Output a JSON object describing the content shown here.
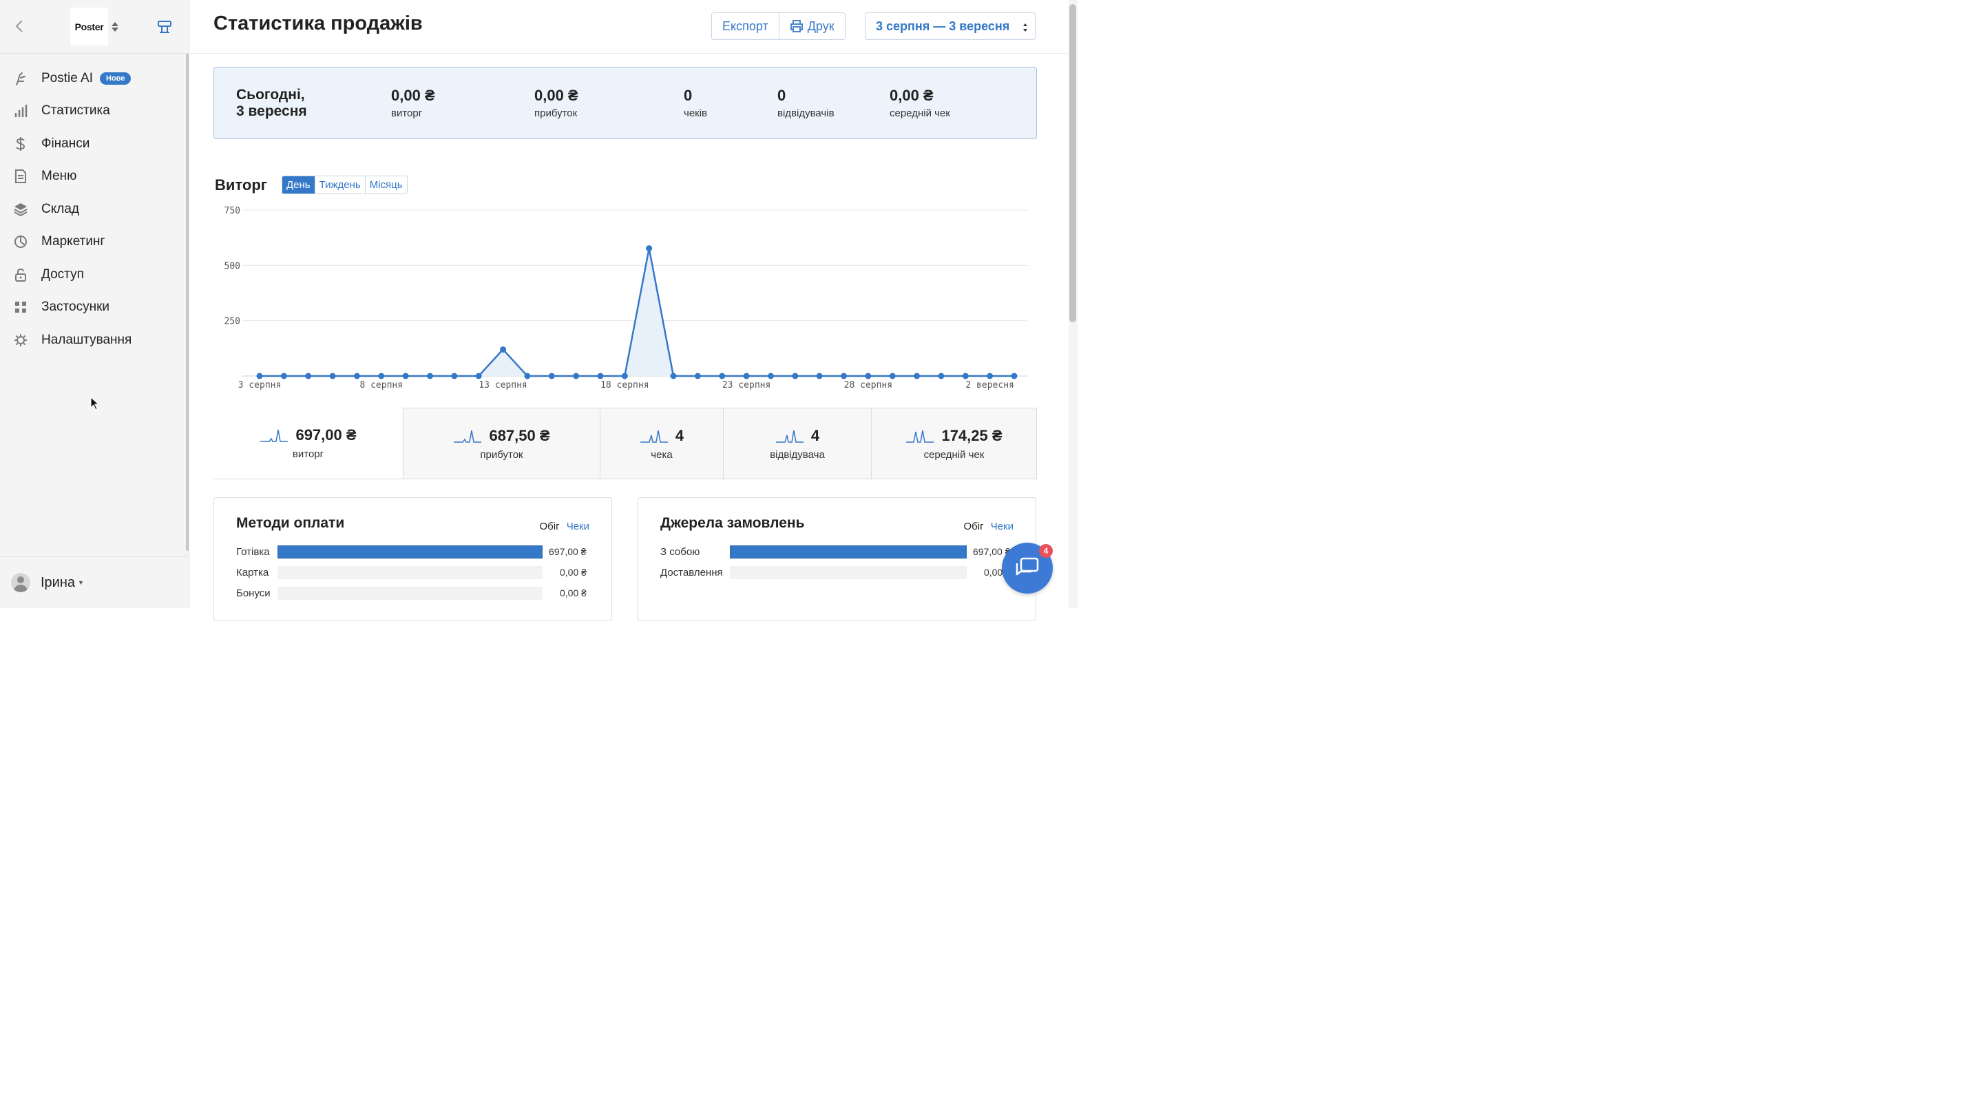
{
  "sidebar": {
    "logo": "Poster",
    "items": [
      {
        "label": "Postie AI",
        "badge": "Нове",
        "icon": "ai-sparkle-icon"
      },
      {
        "label": "Статистика",
        "icon": "bar-chart-icon"
      },
      {
        "label": "Фінанси",
        "icon": "dollar-icon"
      },
      {
        "label": "Меню",
        "icon": "document-icon"
      },
      {
        "label": "Склад",
        "icon": "layers-icon"
      },
      {
        "label": "Маркетинг",
        "icon": "pie-icon"
      },
      {
        "label": "Доступ",
        "icon": "lock-icon"
      },
      {
        "label": "Застосунки",
        "icon": "grid-icon"
      },
      {
        "label": "Налаштування",
        "icon": "gear-icon"
      }
    ],
    "user": "Ірина"
  },
  "header": {
    "title": "Статистика продажів",
    "export_label": "Експорт",
    "print_label": "Друк",
    "date_range": "3 серпня — 3 вересня"
  },
  "today": {
    "title_line1": "Сьогодні,",
    "title_line2": "3 вересня",
    "stats": [
      {
        "value": "0,00 ₴",
        "label": "виторг"
      },
      {
        "value": "0,00 ₴",
        "label": "прибуток"
      },
      {
        "value": "0",
        "label": "чеків"
      },
      {
        "value": "0",
        "label": "відвідувачів"
      },
      {
        "value": "0,00 ₴",
        "label": "середній чек"
      }
    ]
  },
  "revenue": {
    "title": "Виторг",
    "tabs": [
      "День",
      "Тиждень",
      "Місяць"
    ],
    "active_tab": "День"
  },
  "chart_data": {
    "type": "area",
    "title": "Виторг",
    "xlabel": "",
    "ylabel": "",
    "ylim": [
      0,
      750
    ],
    "yticks": [
      "750",
      "500",
      "250"
    ],
    "x": [
      "3 серпня",
      "4 серпня",
      "5 серпня",
      "6 серпня",
      "7 серпня",
      "8 серпня",
      "9 серпня",
      "10 серпня",
      "11 серпня",
      "12 серпня",
      "13 серпня",
      "14 серпня",
      "15 серпня",
      "16 серпня",
      "17 серпня",
      "18 серпня",
      "19 серпня",
      "20 серпня",
      "21 серпня",
      "22 серпня",
      "23 серпня",
      "24 серпня",
      "25 серпня",
      "26 серпня",
      "27 серпня",
      "28 серпня",
      "29 серпня",
      "30 серпня",
      "31 серпня",
      "1 вересня",
      "2 вересня",
      "3 вересня"
    ],
    "xtick_labels": [
      "3 серпня",
      "8 серпня",
      "13 серпня",
      "18 серпня",
      "23 серпня",
      "28 серпня",
      "2 вересня"
    ],
    "series": [
      {
        "values": [
          0,
          0,
          0,
          0,
          0,
          0,
          0,
          0,
          0,
          0,
          120,
          0,
          0,
          0,
          0,
          0,
          577,
          0,
          0,
          0,
          0,
          0,
          0,
          0,
          0,
          0,
          0,
          0,
          0,
          0,
          0,
          0
        ]
      }
    ],
    "grid": true,
    "color": "#3478c8"
  },
  "summary": [
    {
      "value": "697,00 ₴",
      "label": "виторг"
    },
    {
      "value": "687,50 ₴",
      "label": "прибуток"
    },
    {
      "value": "4",
      "label": "чека"
    },
    {
      "value": "4",
      "label": "відвідувача"
    },
    {
      "value": "174,25 ₴",
      "label": "середній чек"
    }
  ],
  "payments": {
    "title": "Методи оплати",
    "tab_turnover": "Обіг",
    "tab_checks": "Чеки",
    "rows": [
      {
        "name": "Готівка",
        "amount": "697,00 ₴",
        "share": 1.0
      },
      {
        "name": "Картка",
        "amount": "0,00 ₴",
        "share": 0
      },
      {
        "name": "Бонуси",
        "amount": "0,00 ₴",
        "share": 0
      }
    ]
  },
  "sources": {
    "title": "Джерела замовлень",
    "tab_turnover": "Обіг",
    "tab_checks": "Чеки",
    "rows": [
      {
        "name": "З собою",
        "amount": "697,00 ₴",
        "share": 1.0
      },
      {
        "name": "Доставлення",
        "amount": "0,00 ₴",
        "share": 0
      }
    ]
  },
  "chat": {
    "badge": "4"
  }
}
